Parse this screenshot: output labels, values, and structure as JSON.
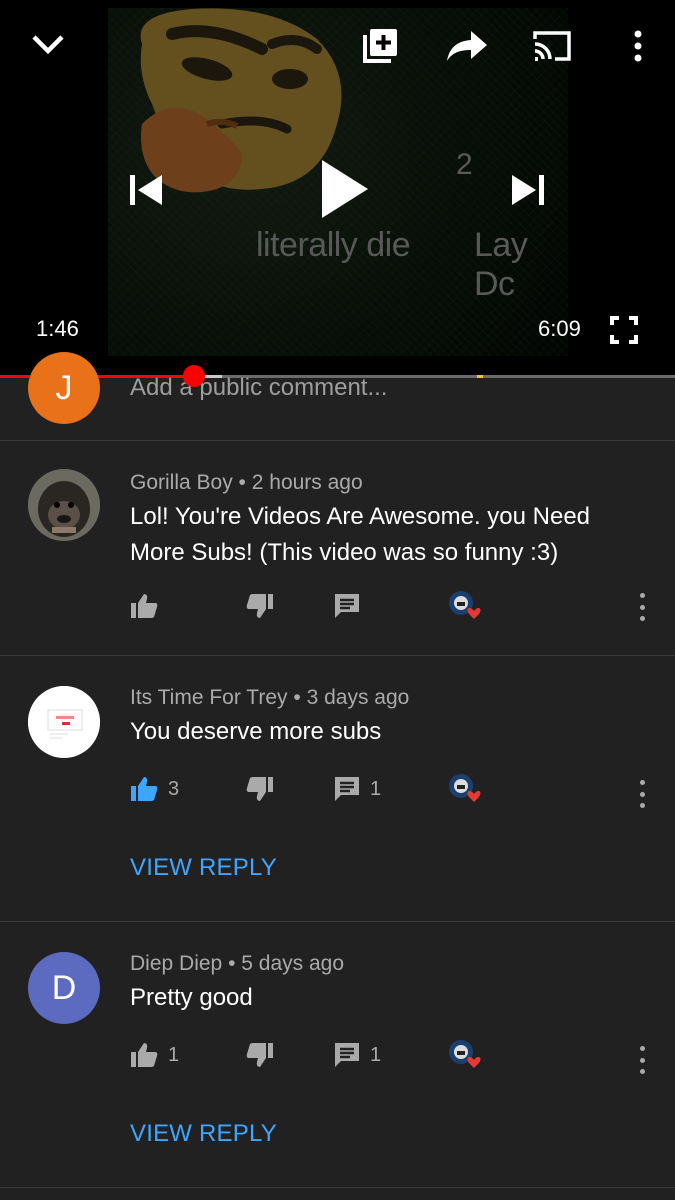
{
  "player": {
    "current_time": "1:46",
    "duration": "6:09",
    "progress_fraction": 0.287,
    "buffered_fraction": 0.329,
    "thumbnail_text_1": "literally die",
    "thumbnail_text_2": "Lay Dc",
    "thumbnail_number": "2",
    "icons": [
      "chevron-down-icon",
      "add-to-playlist-icon",
      "share-icon",
      "cast-icon",
      "more-vert-icon",
      "skip-previous-icon",
      "play-icon",
      "skip-next-icon",
      "fullscreen-icon"
    ]
  },
  "add_comment": {
    "avatar_letter": "J",
    "avatar_color": "#e8711a",
    "placeholder": "Add a public comment..."
  },
  "comments": [
    {
      "author": "Gorilla Boy",
      "time": "2 hours ago",
      "text": "Lol! You're Videos Are Awesome. you Need More Subs! (This video was so funny :3)",
      "likes": "",
      "replies": "",
      "liked": false,
      "view_reply": ""
    },
    {
      "author": "Its Time For Trey",
      "time": "3 days ago",
      "text": "You deserve more subs",
      "likes": "3",
      "replies": "1",
      "liked": true,
      "view_reply": "VIEW REPLY"
    },
    {
      "author": "Diep Diep",
      "time": "5 days ago",
      "text": "Pretty good",
      "likes": "1",
      "replies": "1",
      "liked": false,
      "avatar_letter": "D",
      "avatar_color": "#5c6bc0",
      "view_reply": "VIEW REPLY"
    }
  ],
  "meta_separator": "•",
  "colors": {
    "background": "#212121",
    "accent_link": "#3ea6ff",
    "progress": "#ff0000",
    "liked_thumb": "#3ea6ff"
  }
}
